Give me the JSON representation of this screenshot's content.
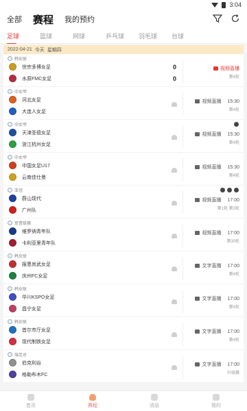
{
  "status": {
    "time": "3:04"
  },
  "top_tabs": [
    {
      "label": "全部",
      "active": false
    },
    {
      "label": "赛程",
      "active": true
    },
    {
      "label": "我的预约",
      "active": false
    }
  ],
  "sports": [
    {
      "label": "足球",
      "active": true
    },
    {
      "label": "篮球",
      "active": false
    },
    {
      "label": "网球",
      "active": false
    },
    {
      "label": "乒乓球",
      "active": false
    },
    {
      "label": "羽毛球",
      "active": false
    },
    {
      "label": "台球",
      "active": false
    }
  ],
  "date_bar": {
    "date": "2022-04-21",
    "today": "今天",
    "weekday": "星期四"
  },
  "matches": [
    {
      "league": "韩女联",
      "home": "世宗多博女足",
      "away": "水原FMC女足",
      "home_score": "0",
      "away_score": "0",
      "status": "视频直播",
      "time": "",
      "round": "第4轮",
      "live": true,
      "avatars": 0,
      "home_color": "#c8a020",
      "away_color": "#b03040"
    },
    {
      "league": "中女甲",
      "home": "河北女足",
      "away": "大连人女足",
      "home_score": "",
      "away_score": "",
      "status": "视频直播",
      "time": "15:30",
      "round": "第4轮",
      "live": false,
      "avatars": 0,
      "home_color": "#e06020",
      "away_color": "#2060c0"
    },
    {
      "league": "中女甲",
      "home": "天津圣德女足",
      "away": "浙江杭州女足",
      "home_score": "",
      "away_score": "",
      "status": "视频直播",
      "time": "15:30",
      "round": "第4轮",
      "live": false,
      "avatars": 1,
      "home_color": "#2050a0",
      "away_color": "#30a040"
    },
    {
      "league": "中女甲",
      "home": "中国女足U17",
      "away": "云南佳仕景",
      "home_score": "",
      "away_score": "",
      "status": "视频直播",
      "time": "15:30",
      "round": "第4轮",
      "live": false,
      "avatars": 0,
      "home_color": "#d04020",
      "away_color": "#d0a020"
    },
    {
      "league": "亚冠",
      "home": "蔚山现代",
      "away": "广州队",
      "home_score": "",
      "away_score": "",
      "status": "视频直播",
      "time": "17:00",
      "round": "第3轮",
      "round_prefix": "第1轮",
      "live": false,
      "avatars": 3,
      "home_color": "#2040a0",
      "away_color": "#d02020"
    },
    {
      "league": "意青联赛",
      "home": "维罗纳青年队",
      "away": "卡利亚里青年队",
      "home_score": "",
      "away_score": "",
      "status": "视频直播",
      "time": "17:00",
      "round": "第30轮",
      "live": false,
      "avatars": 0,
      "home_color": "#1a3a8a",
      "away_color": "#a02030"
    },
    {
      "league": "韩女联",
      "home": "报恩尚武女足",
      "away": "庆州FC女足",
      "home_score": "",
      "away_score": "",
      "status": "文字直播",
      "time": "17:00",
      "round": "第4轮",
      "live": false,
      "avatars": 0,
      "home_color": "#c03030",
      "away_color": "#208040"
    },
    {
      "league": "韩女联",
      "home": "华川KSPO女足",
      "away": "昌宁女足",
      "home_score": "",
      "away_score": "",
      "status": "文字直播",
      "time": "17:00",
      "round": "第4轮",
      "live": false,
      "avatars": 0,
      "home_color": "#4050c0",
      "away_color": "#c04060"
    },
    {
      "league": "韩女联",
      "home": "首尔市厅女足",
      "away": "现代制铁女足",
      "home_score": "",
      "away_score": "",
      "status": "文字直播",
      "time": "17:00",
      "round": "第4轮",
      "live": false,
      "avatars": 0,
      "home_color": "#2070c0",
      "away_color": "#d03040"
    },
    {
      "league": "瑞足总",
      "home": "伯克利谷",
      "away": "格勒布木FC",
      "home_score": "",
      "away_score": "",
      "status": "文字直播",
      "time": "17:00",
      "round": "升级赛",
      "live": false,
      "avatars": 0,
      "home_color": "#909090",
      "away_color": "#5040a0"
    }
  ],
  "bottom_nav": [
    {
      "label": "首页",
      "active": false
    },
    {
      "label": "赛程",
      "active": true
    },
    {
      "label": "消息",
      "active": false
    },
    {
      "label": "我的",
      "active": false
    }
  ]
}
